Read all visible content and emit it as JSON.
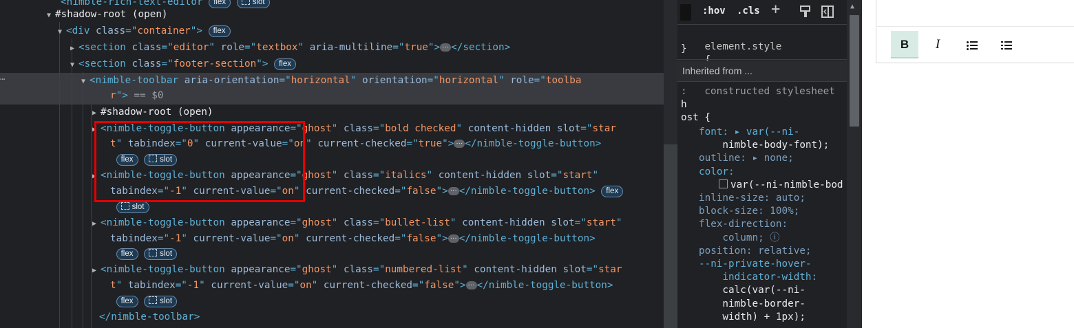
{
  "elements": {
    "lines": [
      {
        "parts": [
          {
            "c": "tag",
            "t": "<nimble-rich-text-editor"
          }
        ],
        "badges": [
          "flex",
          "slot"
        ]
      },
      {
        "parts": [
          {
            "c": "txt",
            "t": "#shadow-root (open)"
          }
        ]
      },
      {
        "parts": [
          {
            "c": "tag",
            "t": "<div "
          },
          {
            "c": "attr",
            "t": "class"
          },
          {
            "c": "tag",
            "t": "=\""
          },
          {
            "c": "val",
            "t": "container"
          },
          {
            "c": "tag",
            "t": "\">"
          }
        ],
        "badges": [
          "flex"
        ]
      },
      {
        "parts": [
          {
            "c": "tag",
            "t": "<section "
          },
          {
            "c": "attr",
            "t": "class"
          },
          {
            "c": "tag",
            "t": "=\""
          },
          {
            "c": "val",
            "t": "editor"
          },
          {
            "c": "tag",
            "t": "\" "
          },
          {
            "c": "attr",
            "t": "role"
          },
          {
            "c": "tag",
            "t": "=\""
          },
          {
            "c": "val",
            "t": "textbox"
          },
          {
            "c": "tag",
            "t": "\" "
          },
          {
            "c": "attr",
            "t": "aria-multiline"
          },
          {
            "c": "tag",
            "t": "=\""
          },
          {
            "c": "val",
            "t": "true"
          },
          {
            "c": "tag",
            "t": "\">"
          }
        ],
        "dots": true,
        "after": [
          {
            "c": "tag",
            "t": "</section>"
          }
        ]
      },
      {
        "parts": [
          {
            "c": "tag",
            "t": "<section "
          },
          {
            "c": "attr",
            "t": "class"
          },
          {
            "c": "tag",
            "t": "=\""
          },
          {
            "c": "val",
            "t": "footer-section"
          },
          {
            "c": "tag",
            "t": "\">"
          }
        ],
        "badges": [
          "flex"
        ]
      },
      {
        "parts": [
          {
            "c": "tag",
            "t": "<nimble-toolbar "
          },
          {
            "c": "attr",
            "t": "aria-orientation"
          },
          {
            "c": "tag",
            "t": "=\""
          },
          {
            "c": "val",
            "t": "horizontal"
          },
          {
            "c": "tag",
            "t": "\" "
          },
          {
            "c": "attr",
            "t": "orientation"
          },
          {
            "c": "tag",
            "t": "=\""
          },
          {
            "c": "val",
            "t": "horizontal"
          },
          {
            "c": "tag",
            "t": "\" "
          },
          {
            "c": "attr",
            "t": "role"
          },
          {
            "c": "tag",
            "t": "=\""
          },
          {
            "c": "val",
            "t": "toolba"
          }
        ]
      },
      {
        "parts": [
          {
            "c": "val",
            "t": "r"
          },
          {
            "c": "tag",
            "t": "\">"
          },
          {
            "c": "dim",
            "t": " == $0"
          }
        ]
      },
      {
        "parts": [
          {
            "c": "txt",
            "t": "#shadow-root (open)"
          }
        ]
      },
      {
        "parts": [
          {
            "c": "tag",
            "t": "<nimble-toggle-button "
          },
          {
            "c": "attr",
            "t": "appearance"
          },
          {
            "c": "tag",
            "t": "=\""
          },
          {
            "c": "val",
            "t": "ghost"
          },
          {
            "c": "tag",
            "t": "\" "
          },
          {
            "c": "attr",
            "t": "class"
          },
          {
            "c": "tag",
            "t": "=\""
          },
          {
            "c": "val",
            "t": "bold checked"
          },
          {
            "c": "tag",
            "t": "\" "
          },
          {
            "c": "attr",
            "t": "content-hidden slot"
          },
          {
            "c": "tag",
            "t": "=\""
          },
          {
            "c": "val",
            "t": "star"
          }
        ]
      },
      {
        "parts": [
          {
            "c": "val",
            "t": "t"
          },
          {
            "c": "tag",
            "t": "\" "
          },
          {
            "c": "attr",
            "t": "tabindex"
          },
          {
            "c": "tag",
            "t": "=\""
          },
          {
            "c": "val",
            "t": "0"
          },
          {
            "c": "tag",
            "t": "\" "
          },
          {
            "c": "attr",
            "t": "current-value"
          },
          {
            "c": "tag",
            "t": "=\""
          },
          {
            "c": "val",
            "t": "on"
          },
          {
            "c": "tag",
            "t": "\" "
          },
          {
            "c": "attr",
            "t": "current-checked"
          },
          {
            "c": "tag",
            "t": "=\""
          },
          {
            "c": "val",
            "t": "true"
          },
          {
            "c": "tag",
            "t": "\">"
          }
        ],
        "dots": true,
        "after": [
          {
            "c": "tag",
            "t": "</nimble-toggle-button>"
          }
        ]
      },
      {
        "parts": [],
        "badges": [
          "flex",
          "slot"
        ]
      },
      {
        "parts": [
          {
            "c": "tag",
            "t": "<nimble-toggle-button "
          },
          {
            "c": "attr",
            "t": "appearance"
          },
          {
            "c": "tag",
            "t": "=\""
          },
          {
            "c": "val",
            "t": "ghost"
          },
          {
            "c": "tag",
            "t": "\" "
          },
          {
            "c": "attr",
            "t": "class"
          },
          {
            "c": "tag",
            "t": "=\""
          },
          {
            "c": "val",
            "t": "italics"
          },
          {
            "c": "tag",
            "t": "\" "
          },
          {
            "c": "attr",
            "t": "content-hidden slot"
          },
          {
            "c": "tag",
            "t": "=\""
          },
          {
            "c": "val",
            "t": "start"
          },
          {
            "c": "tag",
            "t": "\""
          }
        ]
      },
      {
        "parts": [
          {
            "c": "attr",
            "t": "tabindex"
          },
          {
            "c": "tag",
            "t": "=\""
          },
          {
            "c": "val",
            "t": "-1"
          },
          {
            "c": "tag",
            "t": "\" "
          },
          {
            "c": "attr",
            "t": "current-value"
          },
          {
            "c": "tag",
            "t": "=\""
          },
          {
            "c": "val",
            "t": "on"
          },
          {
            "c": "tag",
            "t": "\" "
          },
          {
            "c": "attr",
            "t": "current-checked"
          },
          {
            "c": "tag",
            "t": "=\""
          },
          {
            "c": "val",
            "t": "false"
          },
          {
            "c": "tag",
            "t": "\">"
          }
        ],
        "dots": true,
        "after": [
          {
            "c": "tag",
            "t": "</nimble-toggle-button>"
          }
        ],
        "badges": [
          "flex"
        ]
      },
      {
        "parts": [],
        "badges": [
          "slot"
        ]
      },
      {
        "parts": [
          {
            "c": "tag",
            "t": "<nimble-toggle-button "
          },
          {
            "c": "attr",
            "t": "appearance"
          },
          {
            "c": "tag",
            "t": "=\""
          },
          {
            "c": "val",
            "t": "ghost"
          },
          {
            "c": "tag",
            "t": "\" "
          },
          {
            "c": "attr",
            "t": "class"
          },
          {
            "c": "tag",
            "t": "=\""
          },
          {
            "c": "val",
            "t": "bullet-list"
          },
          {
            "c": "tag",
            "t": "\" "
          },
          {
            "c": "attr",
            "t": "content-hidden slot"
          },
          {
            "c": "tag",
            "t": "=\""
          },
          {
            "c": "val",
            "t": "start"
          },
          {
            "c": "tag",
            "t": "\""
          }
        ]
      },
      {
        "parts": [
          {
            "c": "attr",
            "t": "tabindex"
          },
          {
            "c": "tag",
            "t": "=\""
          },
          {
            "c": "val",
            "t": "-1"
          },
          {
            "c": "tag",
            "t": "\" "
          },
          {
            "c": "attr",
            "t": "current-value"
          },
          {
            "c": "tag",
            "t": "=\""
          },
          {
            "c": "val",
            "t": "on"
          },
          {
            "c": "tag",
            "t": "\" "
          },
          {
            "c": "attr",
            "t": "current-checked"
          },
          {
            "c": "tag",
            "t": "=\""
          },
          {
            "c": "val",
            "t": "false"
          },
          {
            "c": "tag",
            "t": "\">"
          }
        ],
        "dots": true,
        "after": [
          {
            "c": "tag",
            "t": "</nimble-toggle-button>"
          }
        ]
      },
      {
        "parts": [],
        "badges": [
          "flex",
          "slot"
        ]
      },
      {
        "parts": [
          {
            "c": "tag",
            "t": "<nimble-toggle-button "
          },
          {
            "c": "attr",
            "t": "appearance"
          },
          {
            "c": "tag",
            "t": "=\""
          },
          {
            "c": "val",
            "t": "ghost"
          },
          {
            "c": "tag",
            "t": "\" "
          },
          {
            "c": "attr",
            "t": "class"
          },
          {
            "c": "tag",
            "t": "=\""
          },
          {
            "c": "val",
            "t": "numbered-list"
          },
          {
            "c": "tag",
            "t": "\" "
          },
          {
            "c": "attr",
            "t": "content-hidden slot"
          },
          {
            "c": "tag",
            "t": "=\""
          },
          {
            "c": "val",
            "t": "star"
          }
        ]
      },
      {
        "parts": [
          {
            "c": "val",
            "t": "t"
          },
          {
            "c": "tag",
            "t": "\" "
          },
          {
            "c": "attr",
            "t": "tabindex"
          },
          {
            "c": "tag",
            "t": "=\""
          },
          {
            "c": "val",
            "t": "-1"
          },
          {
            "c": "tag",
            "t": "\" "
          },
          {
            "c": "attr",
            "t": "current-value"
          },
          {
            "c": "tag",
            "t": "=\""
          },
          {
            "c": "val",
            "t": "on"
          },
          {
            "c": "tag",
            "t": "\" "
          },
          {
            "c": "attr",
            "t": "current-checked"
          },
          {
            "c": "tag",
            "t": "=\""
          },
          {
            "c": "val",
            "t": "false"
          },
          {
            "c": "tag",
            "t": "\">"
          }
        ],
        "dots": true,
        "after": [
          {
            "c": "tag",
            "t": "</nimble-toggle-button>"
          }
        ]
      },
      {
        "parts": [],
        "badges": [
          "flex",
          "slot"
        ]
      },
      {
        "parts": [
          {
            "c": "tag",
            "t": "</nimble-toolbar>"
          }
        ]
      }
    ]
  },
  "styles": {
    "toolbar": {
      "hov": ":hov",
      "cls": ".cls",
      "add": "+"
    },
    "element_style": {
      "selector": "element.style",
      "open": "{",
      "close": "}"
    },
    "inherited_label": "Inherited from ...",
    "constructed": ":   constructed stylesheet",
    "host_h": "h",
    "host_rest": "ost {",
    "rules": [
      {
        "text": "font: ▸ var(--ni-",
        "kind": "prop"
      },
      {
        "text": "    nimble-body-font);",
        "kind": "txt"
      },
      {
        "text": "outline: ▸ none;",
        "kind": "dim"
      },
      {
        "text": "color:",
        "kind": "prop"
      },
      {
        "text": "var(--ni-nimble-bod",
        "kind": "swatch"
      },
      {
        "text": "inline-size: auto;",
        "kind": "dim"
      },
      {
        "text": "block-size: 100%;",
        "kind": "dim"
      },
      {
        "text": "flex-direction:",
        "kind": "dim"
      },
      {
        "text": "    column; ⓘ",
        "kind": "dim"
      },
      {
        "text": "position: relative;",
        "kind": "dim"
      },
      {
        "text": "--ni-private-hover-",
        "kind": "prop"
      },
      {
        "text": "    indicator-width:",
        "kind": "prop"
      },
      {
        "text": "    calc(var(--ni-",
        "kind": "txt"
      },
      {
        "text": "    nimble-border-",
        "kind": "txt"
      },
      {
        "text": "    width) + 1px);",
        "kind": "txt"
      }
    ]
  },
  "preview": {
    "bold_label": "B",
    "italic_label": "I"
  },
  "colors": {
    "highlight": "#e30000",
    "bold_active": "#d8ece5"
  }
}
